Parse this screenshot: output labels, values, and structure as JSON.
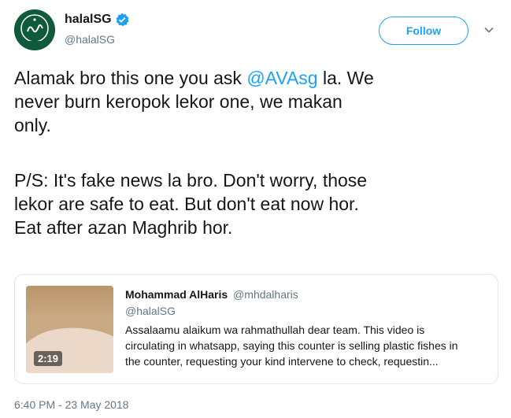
{
  "user": {
    "display_name": "halalSG",
    "handle": "@halalSG",
    "verified": true,
    "avatar_label": "HALAL"
  },
  "actions": {
    "follow_label": "Follow",
    "more_icon": "chevron-down-icon"
  },
  "tweet": {
    "line1_prefix": "Alamak bro this one you ask",
    "line1_mention": "@AVAsg",
    "line1_suffix": " la. We",
    "line2": "never burn keropok lekor one, we makan",
    "line3": "only.",
    "line4": "P/S: It's fake news la bro. Don't worry, those",
    "line5": "lekor are safe to eat. But don't eat now hor.",
    "line6": "Eat after azan Maghrib hor."
  },
  "quoted_tweet": {
    "author_name": "Mohammad AlHaris",
    "author_handle": "@mhdalharis",
    "replying_to": "@halalSG",
    "text_line1": "Assalaamu alaikum wa rahmathullah dear team. This video is",
    "text_line2": "circulating in whatsapp, saying this counter is selling plastic fishes in",
    "text_line3": "the counter, requesting your kind intervene to check, requestin...",
    "video_duration": "2:19"
  },
  "timestamp": "6:40 PM - 23 May 2018",
  "colors": {
    "accent": "#1da1f2",
    "text": "#14171a",
    "muted": "#657786",
    "border": "#e1e8ed"
  }
}
